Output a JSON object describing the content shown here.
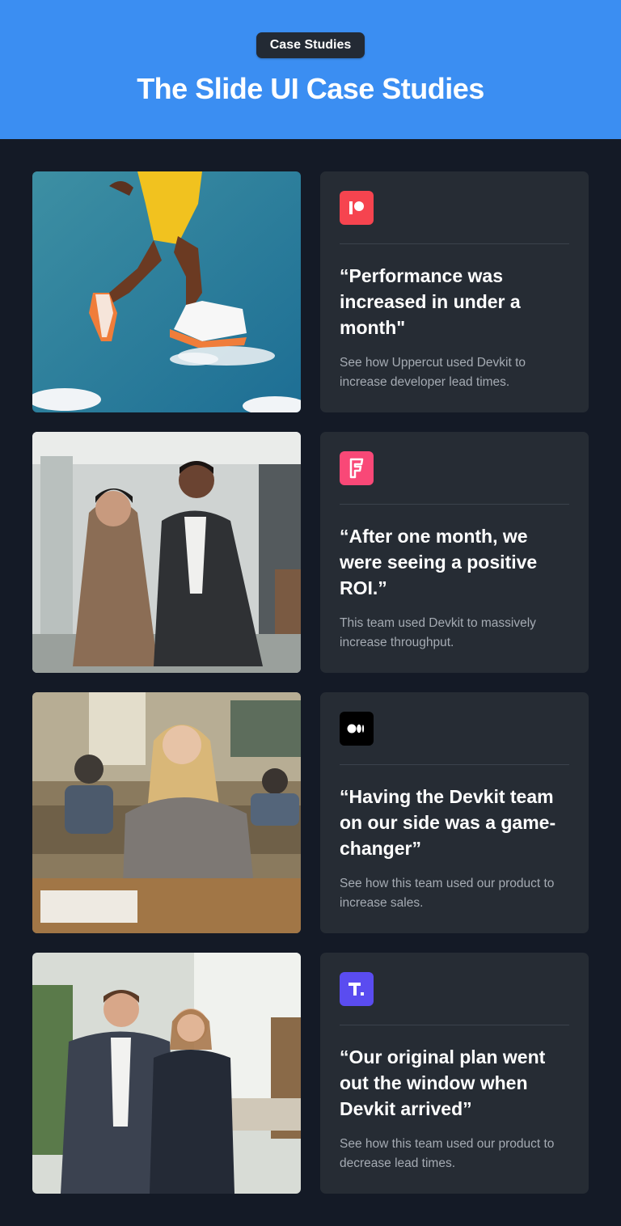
{
  "header": {
    "badge": "Case Studies",
    "title": "The Slide UI Case Studies",
    "background": "#3b8ef2"
  },
  "case_studies": [
    {
      "logo_icon": "patreon-icon",
      "logo_color": "#f6444f",
      "image": "basketball-player-jumping-sky",
      "quote": "“Performance was increased in under a month\"",
      "description": "See how Uppercut used Devkit to increase developer lead times."
    },
    {
      "logo_icon": "foursquare-icon",
      "logo_color": "#f94877",
      "image": "business-couple-office",
      "quote": "“After one month, we were seeing a positive ROI.”",
      "description": "This team used Devkit to massively increase throughput."
    },
    {
      "logo_icon": "medium-icon",
      "logo_color": "#000000",
      "image": "student-in-classroom",
      "quote": "“Having the Devkit team on our side was a game-changer”",
      "description": "See how this team used our product to increase sales."
    },
    {
      "logo_icon": "tailwind-t-icon",
      "logo_color": "#5a4cf0",
      "image": "business-team-office-portrait",
      "quote": "“Our original plan went out the window when Devkit arrived”",
      "description": "See how this team used our product to decrease lead times."
    }
  ]
}
